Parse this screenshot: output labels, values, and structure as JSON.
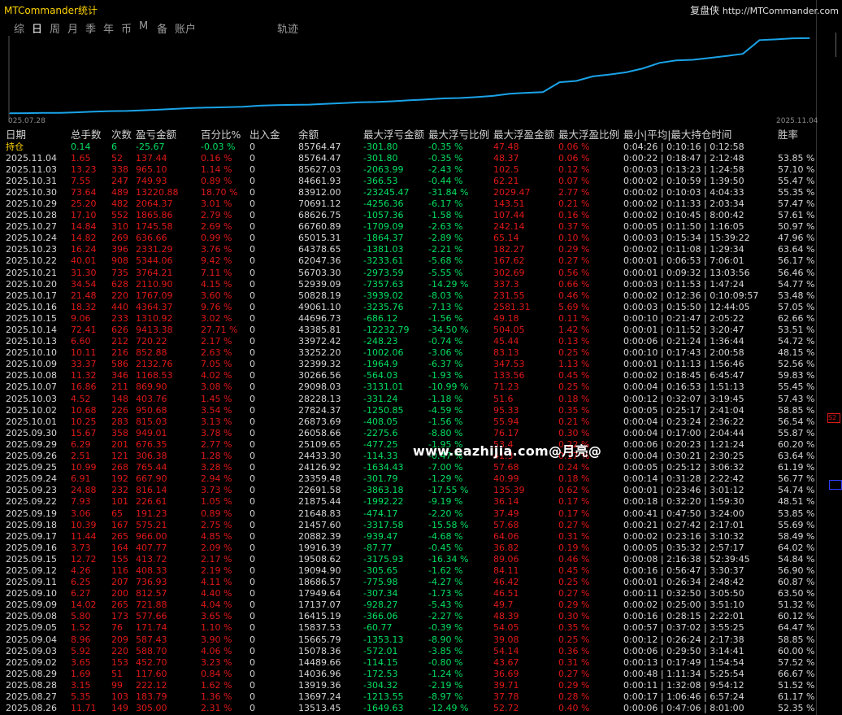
{
  "window": {
    "title": "MTCommander统计",
    "brand_cn": "复盘侠",
    "brand_url": "http://MTCommander.com"
  },
  "tabs": [
    "综",
    "日",
    "周",
    "月",
    "季",
    "年",
    "币",
    "M",
    "备",
    "账户",
    "轨迹"
  ],
  "active_tab": "日",
  "chart": {
    "start_label": "025.07.28",
    "end_label": "2025.11.04",
    "line_color": "#1aa3e8"
  },
  "chart_data": {
    "type": "line",
    "x": [
      "2025.08.26",
      "2025.08.27",
      "2025.08.28",
      "2025.08.29",
      "2025.09.02",
      "2025.09.03",
      "2025.09.04",
      "2025.09.05",
      "2025.09.08",
      "2025.09.09",
      "2025.09.10",
      "2025.09.11",
      "2025.09.12",
      "2025.09.15",
      "2025.09.16",
      "2025.09.17",
      "2025.09.18",
      "2025.09.19",
      "2025.09.22",
      "2025.09.23",
      "2025.09.24",
      "2025.09.25",
      "2025.09.26",
      "2025.09.29",
      "2025.09.30",
      "2025.10.01",
      "2025.10.02",
      "2025.10.03",
      "2025.10.07",
      "2025.10.08",
      "2025.10.09",
      "2025.10.10",
      "2025.10.13",
      "2025.10.14",
      "2025.10.15",
      "2025.10.16",
      "2025.10.17",
      "2025.10.20",
      "2025.10.21",
      "2025.10.22",
      "2025.10.23",
      "2025.10.24",
      "2025.10.27",
      "2025.10.28",
      "2025.10.29",
      "2025.10.30",
      "2025.10.31",
      "2025.11.03",
      "2025.11.04"
    ],
    "values": [
      13513.45,
      13697.24,
      13919.36,
      14036.96,
      14489.66,
      15078.36,
      15665.79,
      15837.53,
      16415.19,
      17137.07,
      17949.64,
      18686.57,
      19094.9,
      19508.62,
      19916.39,
      20882.39,
      21457.6,
      21648.83,
      21875.44,
      22691.58,
      23359.48,
      24126.92,
      24433.3,
      25109.65,
      26058.66,
      26873.69,
      27824.37,
      28228.13,
      29098.03,
      30266.56,
      32399.32,
      33252.2,
      33972.42,
      43385.81,
      44696.73,
      49061.1,
      50828.19,
      52939.09,
      56703.3,
      62047.36,
      64378.65,
      65015.31,
      66760.89,
      68626.75,
      70691.12,
      83912.0,
      84661.93,
      85627.03,
      85764.47
    ]
  },
  "headers": [
    "日期",
    "总手数",
    "次数",
    "盈亏金额",
    "百分比%",
    "出入金",
    "余额",
    "最大浮亏金额",
    "最大浮亏比例",
    "最大浮盈金额",
    "最大浮盈比例",
    "最小|平均|最大持仓时间",
    "胜率"
  ],
  "holding": {
    "label": "持仓",
    "lots": "0.14",
    "count": "6",
    "pnl": "-25.67",
    "pct": "-0.03 %",
    "flow": "0",
    "balance": "85764.47",
    "fl": "-301.80",
    "flp": "-0.35 %",
    "fp": "47.48",
    "fpp": "0.06 %",
    "time": "0:04:26 | 0:10:16 | 0:12:58",
    "win": ""
  },
  "rows": [
    [
      "2025.11.04",
      "1.65",
      "52",
      "137.44",
      "0.16 %",
      "0",
      "85764.47",
      "-301.80",
      "-0.35 %",
      "48.37",
      "0.06 %",
      "0:00:22 | 0:18:47 | 2:12:48",
      "53.85 %"
    ],
    [
      "2025.11.03",
      "13.23",
      "338",
      "965.10",
      "1.14 %",
      "0",
      "85627.03",
      "-2063.99",
      "-2.43 %",
      "102.5",
      "0.12 %",
      "0:00:03 | 0:13:23 | 1:24:58",
      "57.10 %"
    ],
    [
      "2025.10.31",
      "7.55",
      "247",
      "749.93",
      "0.89 %",
      "0",
      "84661.93",
      "-366.53",
      "-0.44 %",
      "62.21",
      "0.07 %",
      "0:00:02 | 0:10:59 | 1:39:50",
      "55.47 %"
    ],
    [
      "2025.10.30",
      "73.64",
      "489",
      "13220.88",
      "18.70 %",
      "0",
      "83912.00",
      "-23245.47",
      "-31.84 %",
      "2029.47",
      "2.77 %",
      "0:00:02 | 0:10:03 | 4:04:33",
      "55.35 %"
    ],
    [
      "2025.10.29",
      "25.20",
      "482",
      "2064.37",
      "3.01 %",
      "0",
      "70691.12",
      "-4256.36",
      "-6.17 %",
      "143.51",
      "0.21 %",
      "0:00:02 | 0:11:33 | 2:03:34",
      "57.47 %"
    ],
    [
      "2025.10.28",
      "17.10",
      "552",
      "1865.86",
      "2.79 %",
      "0",
      "68626.75",
      "-1057.36",
      "-1.58 %",
      "107.44",
      "0.16 %",
      "0:00:02 | 0:10:45 | 8:00:42",
      "57.61 %"
    ],
    [
      "2025.10.27",
      "14.84",
      "310",
      "1745.58",
      "2.69 %",
      "0",
      "66760.89",
      "-1709.09",
      "-2.63 %",
      "242.14",
      "0.37 %",
      "0:00:05 | 0:11:50 | 1:16:05",
      "50.97 %"
    ],
    [
      "2025.10.24",
      "14.82",
      "269",
      "636.66",
      "0.99 %",
      "0",
      "65015.31",
      "-1864.37",
      "-2.89 %",
      "65.14",
      "0.10 %",
      "0:00:03 | 0:15:34 | 15:39:22",
      "47.96 %"
    ],
    [
      "2025.10.23",
      "16.24",
      "396",
      "2331.29",
      "3.76 %",
      "0",
      "64378.65",
      "-1381.03",
      "-2.21 %",
      "182.27",
      "0.29 %",
      "0:00:02 | 0:11:08 | 1:29:34",
      "63.64 %"
    ],
    [
      "2025.10.22",
      "40.01",
      "908",
      "5344.06",
      "9.42 %",
      "0",
      "62047.36",
      "-3233.61",
      "-5.68 %",
      "167.62",
      "0.27 %",
      "0:00:01 | 0:06:53 | 7:06:01",
      "56.17 %"
    ],
    [
      "2025.10.21",
      "31.30",
      "735",
      "3764.21",
      "7.11 %",
      "0",
      "56703.30",
      "-2973.59",
      "-5.55 %",
      "302.69",
      "0.56 %",
      "0:00:01 | 0:09:32 | 13:03:56",
      "56.46 %"
    ],
    [
      "2025.10.20",
      "34.54",
      "628",
      "2110.90",
      "4.15 %",
      "0",
      "52939.09",
      "-7357.63",
      "-14.29 %",
      "337.3",
      "0.66 %",
      "0:00:03 | 0:11:53 | 1:47:24",
      "54.77 %"
    ],
    [
      "2025.10.17",
      "21.48",
      "220",
      "1767.09",
      "3.60 %",
      "0",
      "50828.19",
      "-3939.02",
      "-8.03 %",
      "231.55",
      "0.46 %",
      "0:00:02 | 0:12:36 | 0:10:09:57",
      "53.48 %"
    ],
    [
      "2025.10.16",
      "18.32",
      "440",
      "4364.37",
      "9.76 %",
      "0",
      "49061.10",
      "-3235.76",
      "-7.13 %",
      "2581.31",
      "5.69 %",
      "0:00:03 | 0:15:50 | 12:44:05",
      "57.05 %"
    ],
    [
      "2025.10.15",
      "9.06",
      "233",
      "1310.92",
      "3.02 %",
      "0",
      "44696.73",
      "-686.12",
      "-1.56 %",
      "49.18",
      "0.11 %",
      "0:00:10 | 0:21:47 | 2:05:22",
      "62.66 %"
    ],
    [
      "2025.10.14",
      "72.41",
      "626",
      "9413.38",
      "27.71 %",
      "0",
      "43385.81",
      "-12232.79",
      "-34.50 %",
      "504.05",
      "1.42 %",
      "0:00:01 | 0:11:52 | 3:20:47",
      "53.51 %"
    ],
    [
      "2025.10.13",
      "6.60",
      "212",
      "720.22",
      "2.17 %",
      "0",
      "33972.42",
      "-248.23",
      "-0.74 %",
      "45.44",
      "0.13 %",
      "0:00:06 | 0:21:24 | 1:36:44",
      "54.72 %"
    ],
    [
      "2025.10.10",
      "10.11",
      "216",
      "852.88",
      "2.63 %",
      "0",
      "33252.20",
      "-1002.06",
      "-3.06 %",
      "83.13",
      "0.25 %",
      "0:00:10 | 0:17:43 | 2:00:58",
      "48.15 %"
    ],
    [
      "2025.10.09",
      "33.37",
      "586",
      "2132.76",
      "7.05 %",
      "0",
      "32399.32",
      "-1964.9",
      "-6.37 %",
      "347.53",
      "1.13 %",
      "0:00:01 | 0:11:13 | 1:56:46",
      "52.56 %"
    ],
    [
      "2025.10.08",
      "11.32",
      "346",
      "1168.53",
      "4.02 %",
      "0",
      "30266.56",
      "-564.03",
      "-1.93 %",
      "133.56",
      "0.45 %",
      "0:00:02 | 0:18:45 | 6:45:47",
      "59.83 %"
    ],
    [
      "2025.10.07",
      "16.86",
      "211",
      "869.90",
      "3.08 %",
      "0",
      "29098.03",
      "-3131.01",
      "-10.99 %",
      "71.23",
      "0.25 %",
      "0:00:04 | 0:16:53 | 1:51:13",
      "55.45 %"
    ],
    [
      "2025.10.03",
      "4.52",
      "148",
      "403.76",
      "1.45 %",
      "0",
      "28228.13",
      "-331.24",
      "-1.18 %",
      "51.6",
      "0.18 %",
      "0:00:12 | 0:32:07 | 3:19:45",
      "57.43 %"
    ],
    [
      "2025.10.02",
      "10.68",
      "226",
      "950.68",
      "3.54 %",
      "0",
      "27824.37",
      "-1250.85",
      "-4.59 %",
      "95.33",
      "0.35 %",
      "0:00:05 | 0:25:17 | 2:41:04",
      "58.85 %"
    ],
    [
      "2025.10.01",
      "10.25",
      "283",
      "815.03",
      "3.13 %",
      "0",
      "26873.69",
      "-408.05",
      "-1.56 %",
      "55.94",
      "0.21 %",
      "0:00:04 | 0:23:24 | 2:36:22",
      "56.54 %"
    ],
    [
      "2025.09.30",
      "15.67",
      "358",
      "949.01",
      "3.78 %",
      "0",
      "26058.66",
      "-2275.6",
      "-8.80 %",
      "76.17",
      "0.30 %",
      "0:00:04 | 0:17:00 | 2:04:44",
      "55.87 %"
    ],
    [
      "2025.09.29",
      "6.29",
      "201",
      "676.35",
      "2.77 %",
      "0",
      "25109.65",
      "-477.25",
      "-1.95 %",
      "53.4",
      "0.22 %",
      "0:00:06 | 0:20:23 | 1:21:24",
      "60.20 %"
    ],
    [
      "2025.09.26",
      "2.51",
      "121",
      "306.38",
      "1.28 %",
      "0",
      "24433.30",
      "-114.33",
      "-0.47 %",
      "41.3",
      "0.17 %",
      "0:00:04 | 0:30:21 | 2:30:25",
      "63.64 %"
    ],
    [
      "2025.09.25",
      "10.99",
      "268",
      "765.44",
      "3.28 %",
      "0",
      "24126.92",
      "-1634.43",
      "-7.00 %",
      "57.68",
      "0.24 %",
      "0:00:05 | 0:25:12 | 3:06:32",
      "61.19 %"
    ],
    [
      "2025.09.24",
      "6.91",
      "192",
      "667.90",
      "2.94 %",
      "0",
      "23359.48",
      "-301.79",
      "-1.29 %",
      "40.99",
      "0.18 %",
      "0:00:14 | 0:31:28 | 2:22:42",
      "56.77 %"
    ],
    [
      "2025.09.23",
      "24.88",
      "232",
      "816.14",
      "3.73 %",
      "0",
      "22691.58",
      "-3863.18",
      "-17.55 %",
      "135.39",
      "0.62 %",
      "0:00:01 | 0:23:46 | 3:01:12",
      "54.74 %"
    ],
    [
      "2025.09.22",
      "7.93",
      "101",
      "226.61",
      "1.05 %",
      "0",
      "21875.44",
      "-1992.22",
      "-9.19 %",
      "36.14",
      "0.17 %",
      "0:00:18 | 0:32:20 | 1:59:30",
      "48.51 %"
    ],
    [
      "2025.09.19",
      "3.06",
      "65",
      "191.23",
      "0.89 %",
      "0",
      "21648.83",
      "-474.17",
      "-2.20 %",
      "37.49",
      "0.17 %",
      "0:00:41 | 0:47:50 | 3:24:00",
      "53.85 %"
    ],
    [
      "2025.09.18",
      "10.39",
      "167",
      "575.21",
      "2.75 %",
      "0",
      "21457.60",
      "-3317.58",
      "-15.58 %",
      "57.68",
      "0.27 %",
      "0:00:21 | 0:27:42 | 2:17:01",
      "55.69 %"
    ],
    [
      "2025.09.17",
      "11.44",
      "265",
      "966.00",
      "4.85 %",
      "0",
      "20882.39",
      "-939.47",
      "-4.68 %",
      "64.06",
      "0.31 %",
      "0:00:02 | 0:23:16 | 3:10:32",
      "58.49 %"
    ],
    [
      "2025.09.16",
      "3.73",
      "164",
      "407.77",
      "2.09 %",
      "0",
      "19916.39",
      "-87.77",
      "-0.45 %",
      "36.82",
      "0.19 %",
      "0:00:05 | 0:35:32 | 2:57:17",
      "64.02 %"
    ],
    [
      "2025.09.15",
      "12.72",
      "155",
      "413.72",
      "2.17 %",
      "0",
      "19508.62",
      "-3175.93",
      "-16.34 %",
      "89.06",
      "0.46 %",
      "0:00:08 | 2:16:38 | 52:39:45",
      "54.84 %"
    ],
    [
      "2025.09.12",
      "4.26",
      "116",
      "408.33",
      "2.19 %",
      "0",
      "19094.90",
      "-305.65",
      "-1.62 %",
      "84.11",
      "0.45 %",
      "0:00:16 | 0:56:47 | 3:30:37",
      "56.90 %"
    ],
    [
      "2025.09.11",
      "6.25",
      "207",
      "736.93",
      "4.11 %",
      "0",
      "18686.57",
      "-775.98",
      "-4.27 %",
      "46.42",
      "0.25 %",
      "0:00:01 | 0:26:34 | 2:48:42",
      "60.87 %"
    ],
    [
      "2025.09.10",
      "6.27",
      "200",
      "812.57",
      "4.40 %",
      "0",
      "17949.64",
      "-307.34",
      "-1.73 %",
      "46.51",
      "0.27 %",
      "0:00:11 | 0:32:50 | 3:05:50",
      "63.50 %"
    ],
    [
      "2025.09.09",
      "14.02",
      "265",
      "721.88",
      "4.04 %",
      "0",
      "17137.07",
      "-928.27",
      "-5.43 %",
      "49.7",
      "0.29 %",
      "0:00:02 | 0:25:00 | 3:51:10",
      "51.32 %"
    ],
    [
      "2025.09.08",
      "5.80",
      "173",
      "577.66",
      "3.65 %",
      "0",
      "16415.19",
      "-366.06",
      "-2.27 %",
      "48.39",
      "0.30 %",
      "0:00:16 | 0:28:15 | 2:22:01",
      "60.12 %"
    ],
    [
      "2025.09.05",
      "1.52",
      "76",
      "171.74",
      "1.10 %",
      "0",
      "15837.53",
      "-60.77",
      "-0.39 %",
      "54.05",
      "0.35 %",
      "0:00:57 | 0:37:02 | 3:55:25",
      "64.47 %"
    ],
    [
      "2025.09.04",
      "8.96",
      "209",
      "587.43",
      "3.90 %",
      "0",
      "15665.79",
      "-1353.13",
      "-8.90 %",
      "39.08",
      "0.25 %",
      "0:00:12 | 0:26:24 | 2:17:38",
      "58.85 %"
    ],
    [
      "2025.09.03",
      "5.92",
      "220",
      "588.70",
      "4.06 %",
      "0",
      "15078.36",
      "-572.01",
      "-3.85 %",
      "54.14",
      "0.36 %",
      "0:00:06 | 0:29:50 | 3:14:41",
      "60.00 %"
    ],
    [
      "2025.09.02",
      "3.65",
      "153",
      "452.70",
      "3.23 %",
      "0",
      "14489.66",
      "-114.15",
      "-0.80 %",
      "43.67",
      "0.31 %",
      "0:00:13 | 0:17:49 | 1:54:54",
      "57.52 %"
    ],
    [
      "2025.08.29",
      "1.69",
      "51",
      "117.60",
      "0.84 %",
      "0",
      "14036.96",
      "-172.53",
      "-1.24 %",
      "36.69",
      "0.27 %",
      "0:00:48 | 1:11:34 | 5:25:54",
      "66.67 %"
    ],
    [
      "2025.08.28",
      "3.15",
      "99",
      "222.12",
      "1.62 %",
      "0",
      "13919.36",
      "-304.32",
      "-2.19 %",
      "39.71",
      "0.29 %",
      "0:00:11 | 1:32:08 | 9:54:12",
      "51.52 %"
    ],
    [
      "2025.08.27",
      "5.35",
      "103",
      "183.79",
      "1.36 %",
      "0",
      "13697.24",
      "-1213.55",
      "-8.97 %",
      "37.78",
      "0.28 %",
      "0:00:17 | 1:06:46 | 6:57:24",
      "61.17 %"
    ],
    [
      "2025.08.26",
      "11.71",
      "149",
      "305.00",
      "2.31 %",
      "0",
      "13513.45",
      "-1649.63",
      "-12.49 %",
      "52.72",
      "0.40 %",
      "0:00:06 | 0:47:06 | 8:01:00",
      "52.35 %"
    ]
  ],
  "watermark": "www.eazhijia.com@月亮@",
  "side_markers": {
    "red_label": "S2"
  }
}
